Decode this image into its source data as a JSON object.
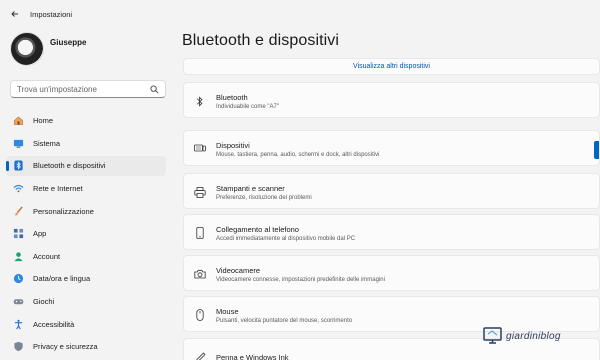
{
  "app": {
    "title": "Impostazioni"
  },
  "profile": {
    "name": "Giuseppe"
  },
  "search": {
    "placeholder": "Trova un'impostazione"
  },
  "nav": {
    "items": [
      {
        "label": "Home",
        "icon": "home-icon",
        "active": false
      },
      {
        "label": "Sistema",
        "icon": "system-icon",
        "active": false
      },
      {
        "label": "Bluetooth e dispositivi",
        "icon": "bluetooth-icon",
        "active": true
      },
      {
        "label": "Rete e Internet",
        "icon": "network-icon",
        "active": false
      },
      {
        "label": "Personalizzazione",
        "icon": "brush-icon",
        "active": false
      },
      {
        "label": "App",
        "icon": "apps-icon",
        "active": false
      },
      {
        "label": "Account",
        "icon": "account-icon",
        "active": false
      },
      {
        "label": "Data/ora e lingua",
        "icon": "time-language-icon",
        "active": false
      },
      {
        "label": "Giochi",
        "icon": "gaming-icon",
        "active": false
      },
      {
        "label": "Accessibilità",
        "icon": "accessibility-icon",
        "active": false
      },
      {
        "label": "Privacy e sicurezza",
        "icon": "privacy-shield-icon",
        "active": false
      }
    ]
  },
  "main": {
    "title": "Bluetooth e dispositivi",
    "more_link": "Visualizza altri dispositivi",
    "bluetooth": {
      "title": "Bluetooth",
      "subtitle": "Individuabile come \"A7\""
    },
    "rows": [
      {
        "title": "Dispositivi",
        "subtitle": "Mouse, tastiera, penna, audio, schermi e dock, altri dispositivi",
        "icon": "devices-icon"
      },
      {
        "title": "Stampanti e scanner",
        "subtitle": "Preferenze, risoluzione dei problemi",
        "icon": "printer-icon"
      },
      {
        "title": "Collegamento al telefono",
        "subtitle": "Accedi immediatamente al dispositivo mobile dal PC",
        "icon": "phone-icon"
      },
      {
        "title": "Videocamere",
        "subtitle": "Videocamere connesse, impostazioni predefinite delle immagini",
        "icon": "camera-icon"
      },
      {
        "title": "Mouse",
        "subtitle": "Pulsanti, velocità puntatore del mouse, scorrimento",
        "icon": "mouse-icon"
      },
      {
        "title": "Penna e Windows Ink",
        "subtitle": "",
        "icon": "pen-icon"
      }
    ]
  },
  "watermark": {
    "text": "giardiniblog"
  },
  "colors": {
    "accent": "#0067c0",
    "link": "#0058b3",
    "background": "#f3f3f3",
    "card": "#fbfbfb"
  }
}
